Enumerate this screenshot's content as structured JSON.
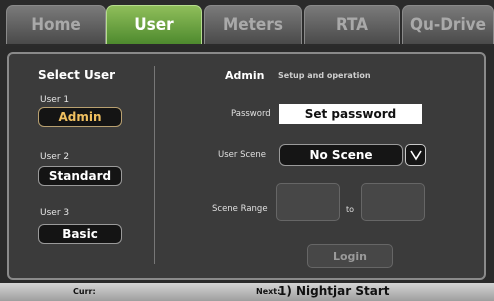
{
  "tabs": [
    {
      "label": "Home",
      "active": false
    },
    {
      "label": "User",
      "active": true
    },
    {
      "label": "Meters",
      "active": false
    },
    {
      "label": "RTA",
      "active": false
    },
    {
      "label": "Qu-Drive",
      "active": false
    }
  ],
  "select_user": {
    "title": "Select User",
    "users": [
      {
        "caption": "User 1",
        "button": "Admin",
        "selected": true
      },
      {
        "caption": "User 2",
        "button": "Standard",
        "selected": false
      },
      {
        "caption": "User 3",
        "button": "Basic",
        "selected": false
      }
    ]
  },
  "admin": {
    "title": "Admin",
    "subtitle": "Setup and operation",
    "password_label": "Password",
    "password_button": "Set password",
    "user_scene_label": "User Scene",
    "user_scene_value": "No Scene",
    "scene_range_label": "Scene Range",
    "to_label": "to",
    "login_label": "Login"
  },
  "status_bar": {
    "curr_label": "Curr:",
    "next_label": "Next:",
    "next_value": "1) Nightjar Start"
  },
  "colors": {
    "active_tab": "#6aa33f",
    "selected_user_text": "#f0c060"
  }
}
